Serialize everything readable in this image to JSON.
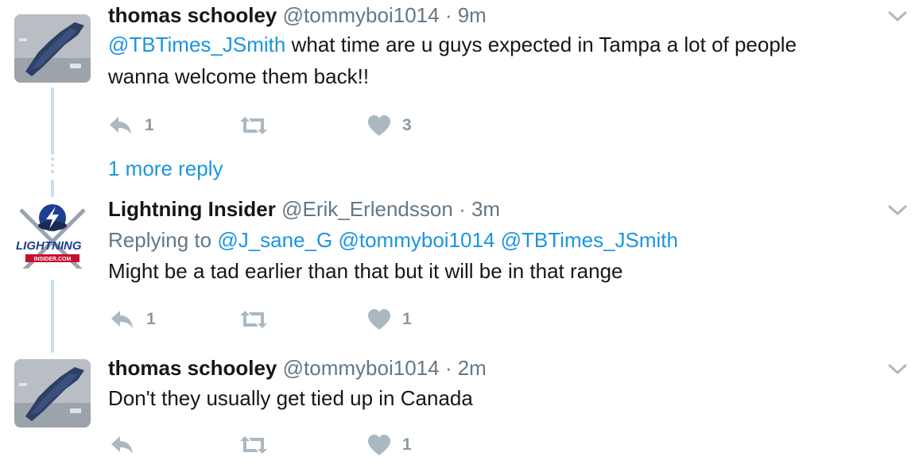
{
  "tweets": [
    {
      "name": "thomas schooley",
      "handle": "@tommyboi1014",
      "separator": "·",
      "time": "9m",
      "mention": "@TBTimes_JSmith",
      "text_line1": " what time are u guys expected in Tampa a lot of people",
      "text_line2": "wanna welcome them back!!",
      "reply_count": "1",
      "retweet_count": "",
      "like_count": "3"
    },
    {
      "name": "Lightning Insider",
      "handle": "@Erik_Erlendsson",
      "separator": "·",
      "time": "3m",
      "replying_label": "Replying to",
      "replying_to": [
        "@J_sane_G",
        "@tommyboi1014",
        "@TBTimes_JSmith"
      ],
      "text": "Might be a tad earlier than that but it will be in that range",
      "reply_count": "1",
      "retweet_count": "",
      "like_count": "1",
      "avatar_logo_text": "LIGHTNING",
      "avatar_logo_sub": "INSIDER.COM"
    },
    {
      "name": "thomas schooley",
      "handle": "@tommyboi1014",
      "separator": "·",
      "time": "2m",
      "text": "Don't they usually get tied up in Canada",
      "reply_count": "",
      "retweet_count": "",
      "like_count": "1"
    }
  ],
  "more_replies_label": "1 more reply",
  "colors": {
    "link": "#1b95e0",
    "muted": "#657786",
    "icon": "#aab8c2",
    "thread_line": "#c4dff2"
  },
  "icons": [
    "reply-icon",
    "retweet-icon",
    "heart-icon",
    "chevron-down-icon"
  ]
}
